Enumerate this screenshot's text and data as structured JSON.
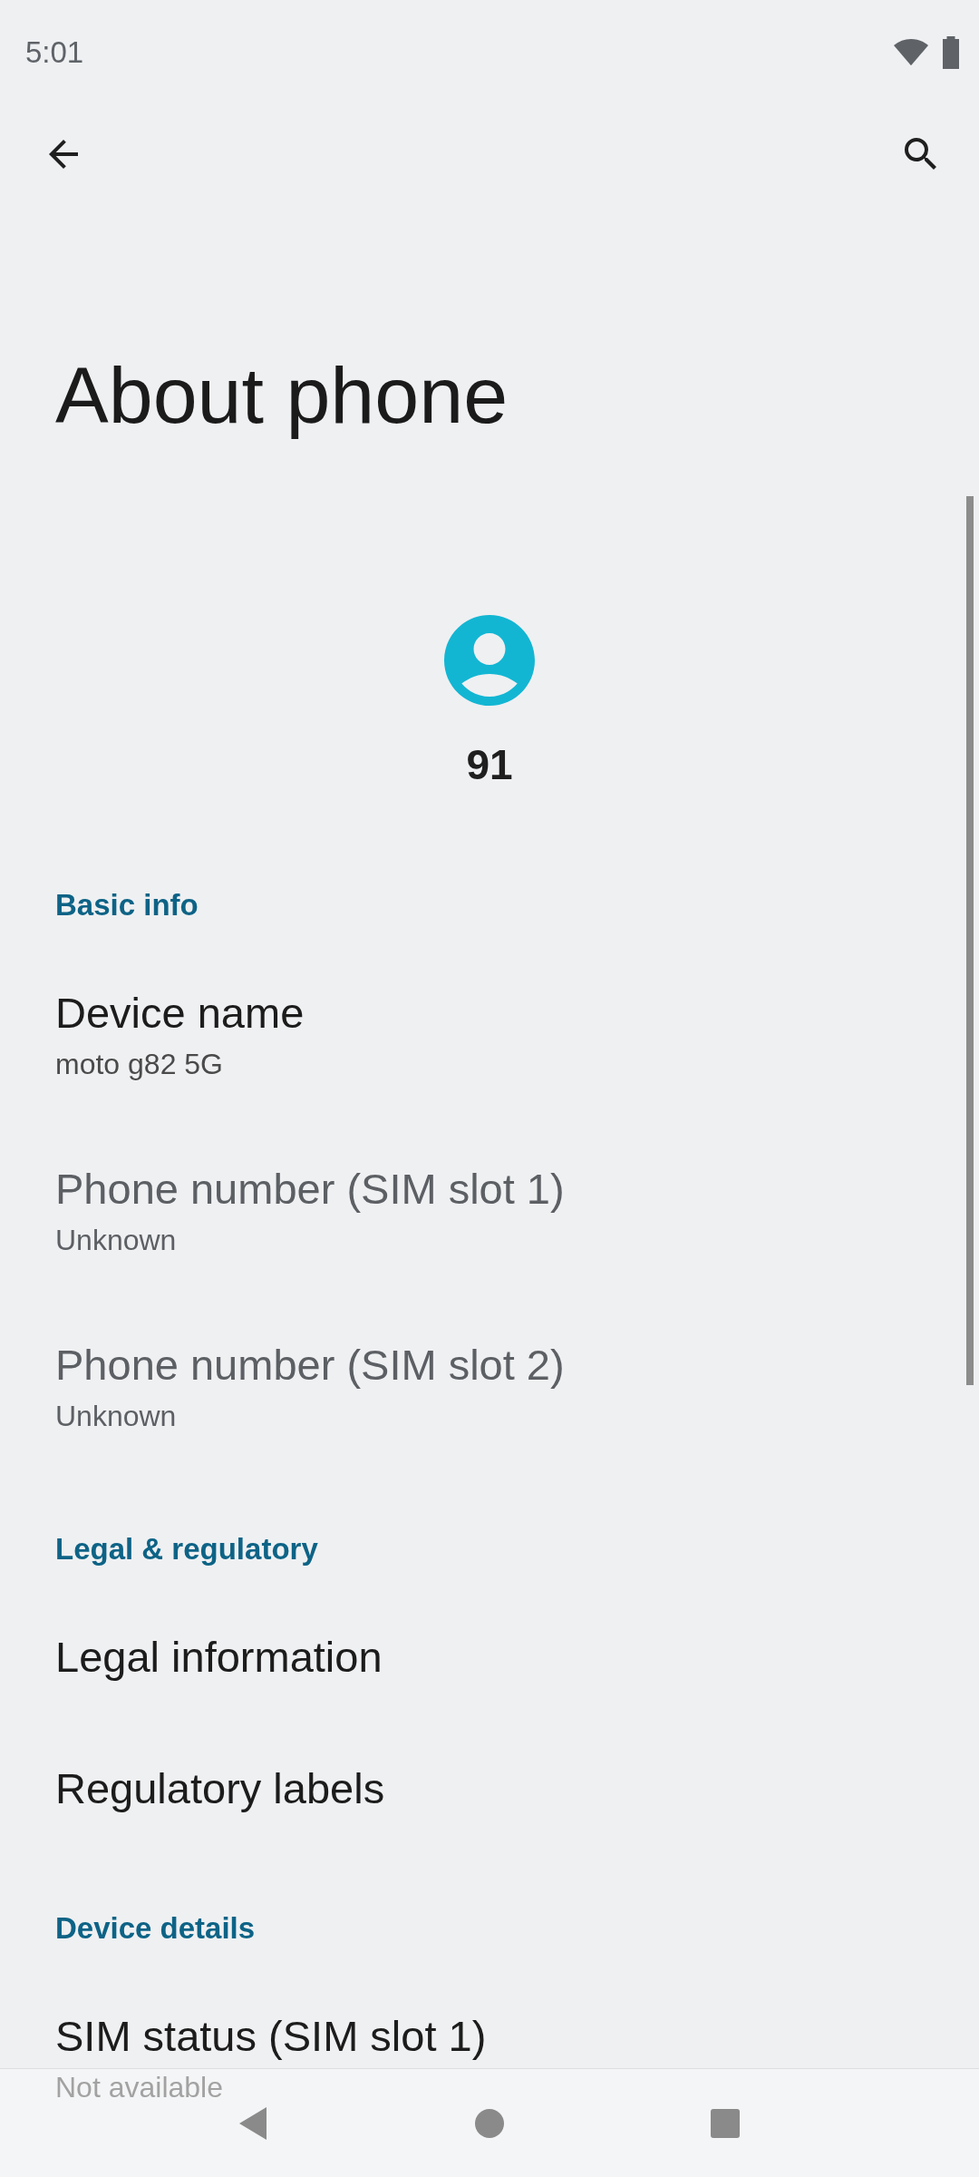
{
  "status_bar": {
    "time": "5:01"
  },
  "title": "About phone",
  "profile": {
    "name": "91"
  },
  "sections": [
    {
      "header": "Basic info",
      "items": [
        {
          "title": "Device name",
          "summary": "moto g82 5G",
          "disabled": false
        },
        {
          "title": "Phone number (SIM slot 1)",
          "summary": "Unknown",
          "disabled": true
        },
        {
          "title": "Phone number (SIM slot 2)",
          "summary": "Unknown",
          "disabled": true
        }
      ]
    },
    {
      "header": "Legal & regulatory",
      "items": [
        {
          "title": "Legal information",
          "disabled": false
        },
        {
          "title": "Regulatory labels",
          "disabled": false
        }
      ]
    },
    {
      "header": "Device details",
      "items": [
        {
          "title": "SIM status (SIM slot 1)",
          "summary": "Not available",
          "disabled": false
        }
      ]
    }
  ]
}
